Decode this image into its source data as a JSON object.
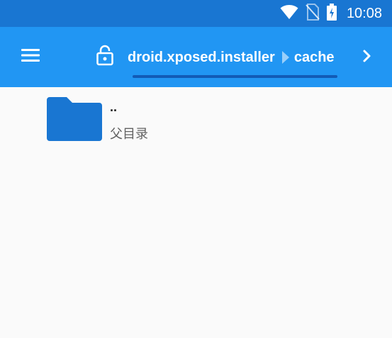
{
  "status_bar": {
    "time": "10:08",
    "icons": [
      "wifi-icon",
      "no-sim-icon",
      "battery-charging-icon"
    ],
    "background": "#1976d2"
  },
  "toolbar": {
    "background": "#2196f3",
    "menu_icon": "menu-icon",
    "lock_icon": "lock-icon",
    "forward_icon": "chevron-right-icon",
    "breadcrumb": [
      "droid.xposed.installer",
      "cache"
    ]
  },
  "file_list": {
    "items": [
      {
        "name": "..",
        "description": "父目录",
        "icon": "folder-icon",
        "icon_color": "#1976d2"
      }
    ]
  }
}
